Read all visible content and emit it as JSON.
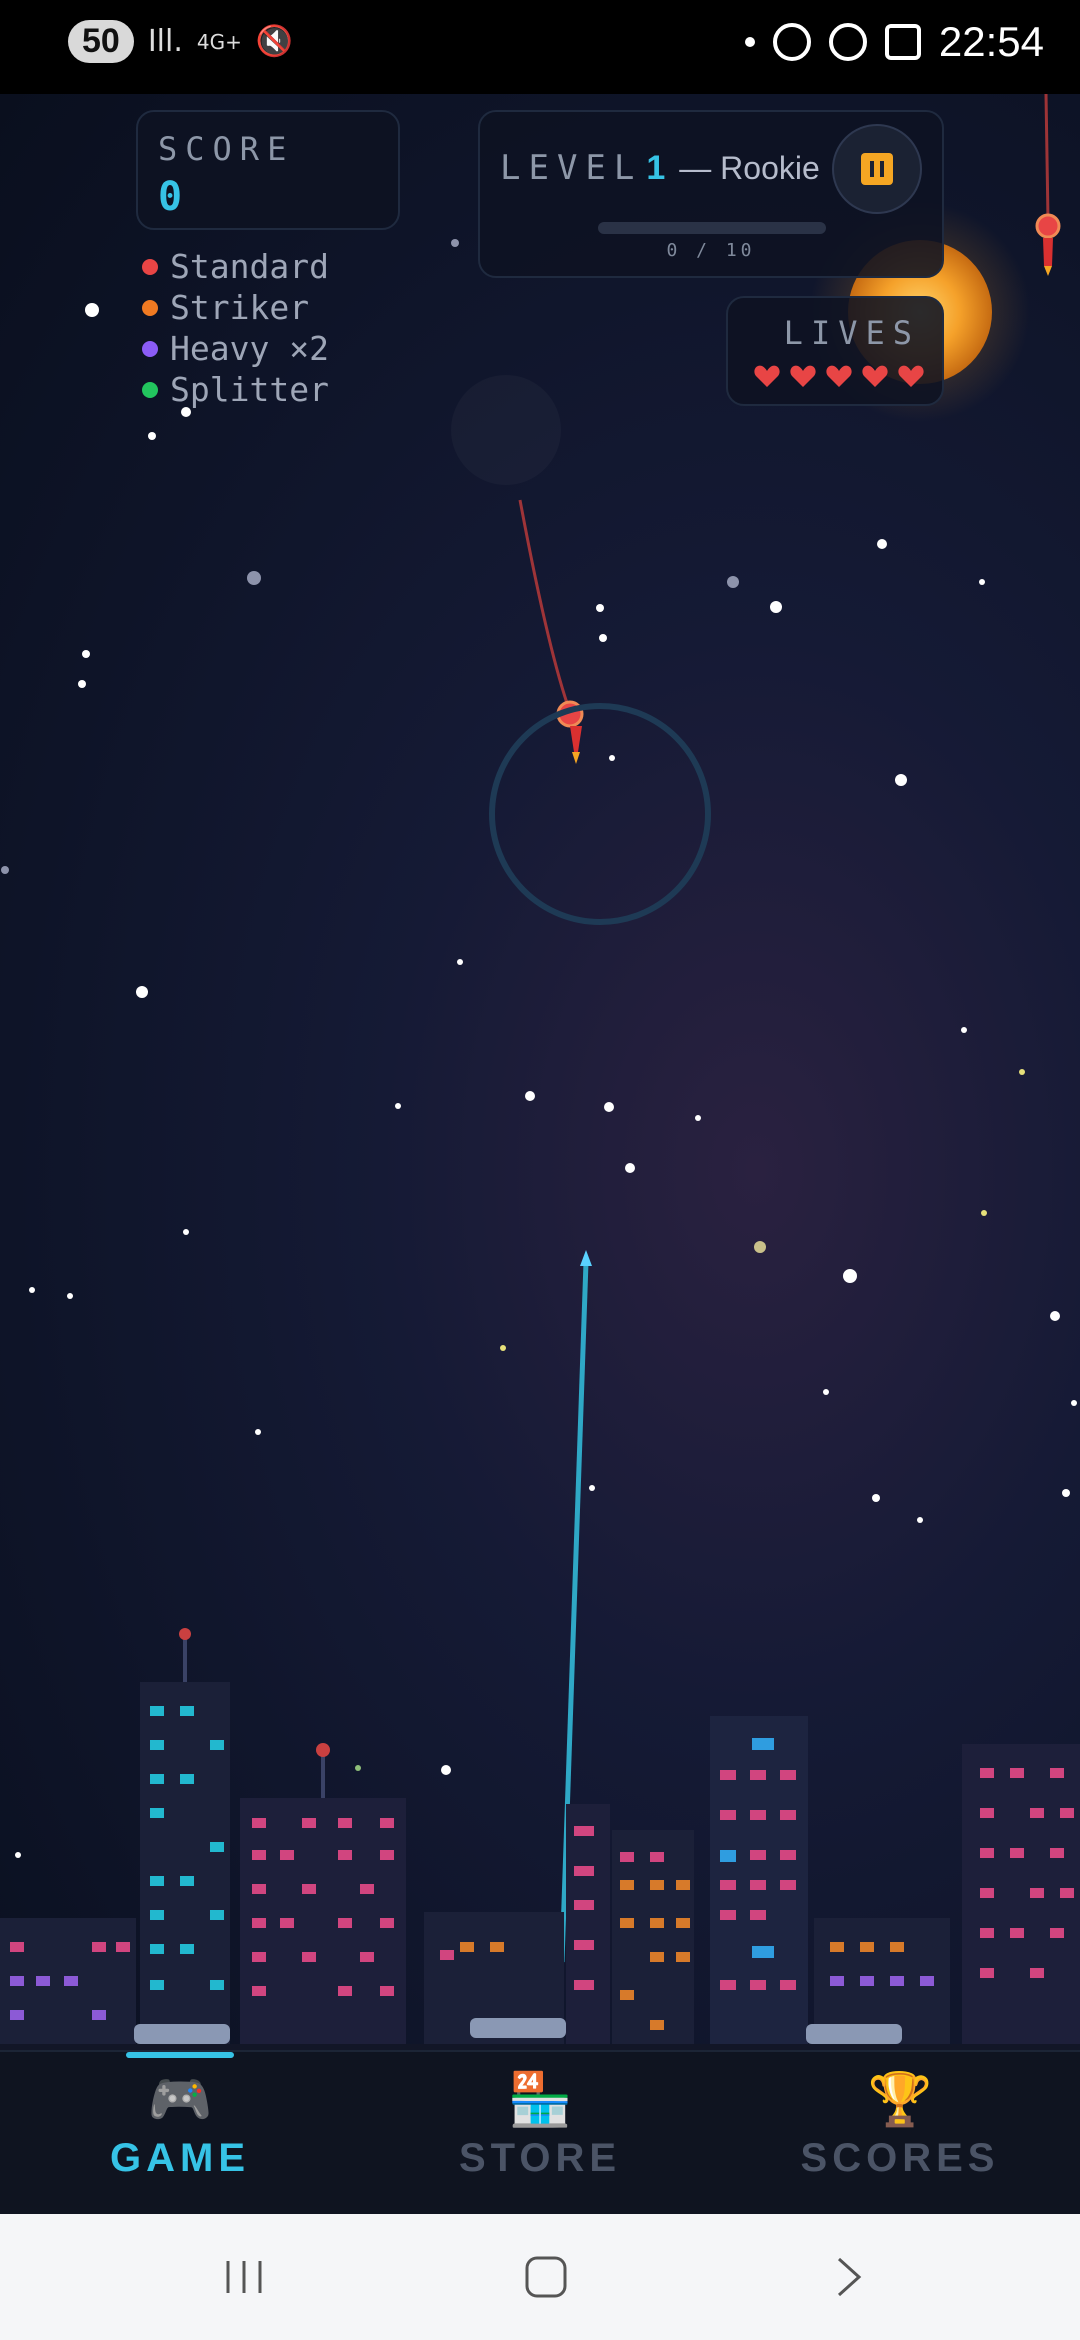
{
  "status_bar": {
    "badge": "50",
    "network": "4G+",
    "time": "22:54",
    "icons": [
      "signal-icon",
      "network-4g-icon",
      "mute-icon",
      "notification-dot-icon",
      "whatsapp-icon",
      "whatsapp-icon",
      "screenshot-icon"
    ]
  },
  "hud": {
    "score_label": "SCORE",
    "score_value": "0",
    "level_label": "LEVEL",
    "level_number": "1",
    "level_rank": "— Rookie",
    "level_progress_text": "0 / 10",
    "level_progress": 0.0,
    "lives_label": "LIVES",
    "lives_count": 5
  },
  "legend": [
    {
      "label": "Standard",
      "color": "#e84545"
    },
    {
      "label": "Striker",
      "color": "#f07a22"
    },
    {
      "label": "Heavy ×2",
      "color": "#8b5cf6"
    },
    {
      "label": "Splitter",
      "color": "#22c55e"
    }
  ],
  "bottom_nav": {
    "active": "game",
    "items": [
      {
        "id": "game",
        "label": "GAME",
        "icon": "game-controller-icon",
        "glyph": "🎮"
      },
      {
        "id": "store",
        "label": "STORE",
        "icon": "store-icon",
        "glyph": "🏪"
      },
      {
        "id": "scores",
        "label": "SCORES",
        "icon": "trophy-icon",
        "glyph": "🏆"
      }
    ]
  },
  "system_nav": {
    "buttons": [
      "recent-apps-icon",
      "home-icon",
      "back-icon"
    ]
  },
  "colors": {
    "accent": "#36c3e6",
    "pause": "#f5a623",
    "heart": "#e84545",
    "inactive_nav": "#4b5466"
  }
}
